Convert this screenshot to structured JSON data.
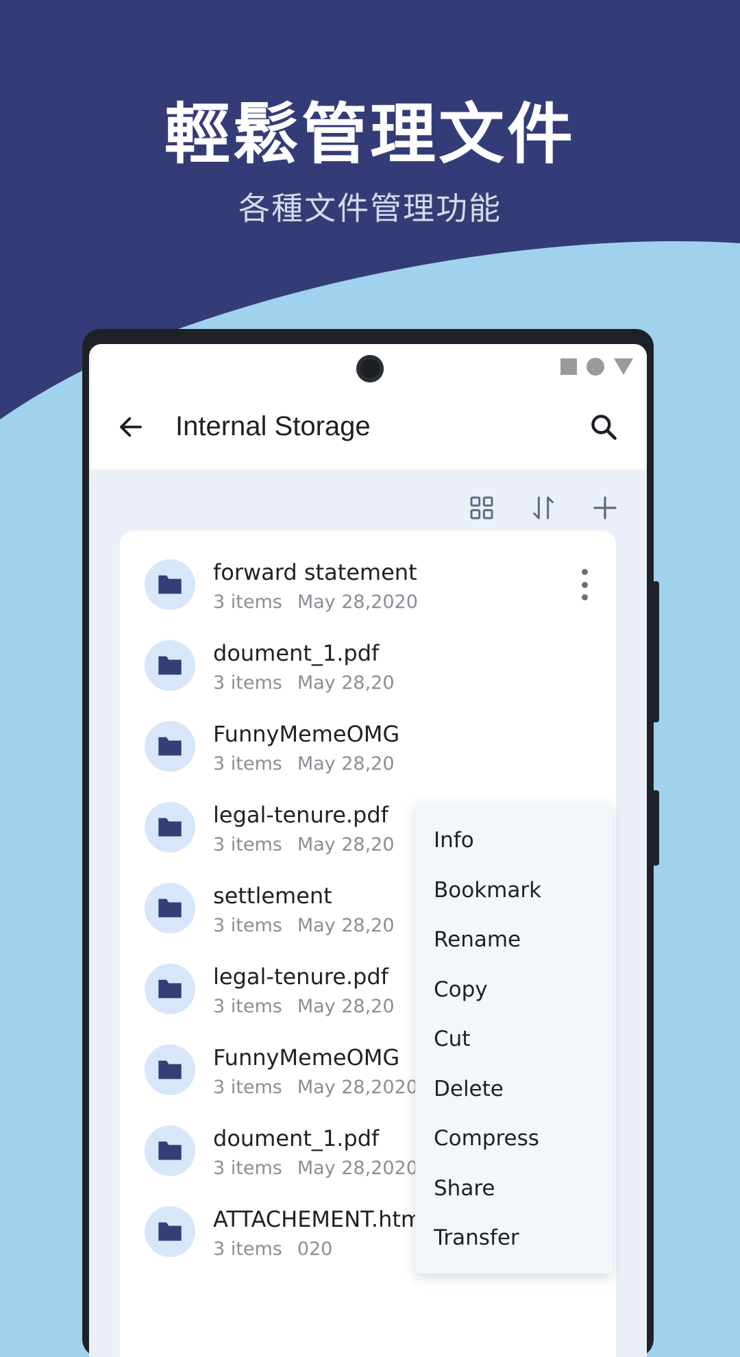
{
  "promo": {
    "title": "輕鬆管理文件",
    "subtitle": "各種文件管理功能"
  },
  "colors": {
    "navy": "#343c77",
    "sky": "#a0d2ee",
    "folder": "#353e75",
    "folder_bg": "#d8e6f9",
    "screen_bg": "#ebf0f8"
  },
  "app_bar": {
    "back_icon": "arrow-left-icon",
    "title": "Internal Storage",
    "search_icon": "search-icon"
  },
  "toolbar": {
    "grid_icon": "grid-view-icon",
    "sort_icon": "sort-icon",
    "add_icon": "plus-icon"
  },
  "files": [
    {
      "name": "forward statement",
      "items": "3 items",
      "date": "May 28,2020"
    },
    {
      "name": "doument_1.pdf",
      "items": "3 items",
      "date": "May 28,20"
    },
    {
      "name": "FunnyMemeOMG",
      "items": "3 items",
      "date": "May 28,20"
    },
    {
      "name": "legal-tenure.pdf",
      "items": "3 items",
      "date": "May 28,20"
    },
    {
      "name": "settlement",
      "items": "3 items",
      "date": "May 28,20"
    },
    {
      "name": "legal-tenure.pdf",
      "items": "3 items",
      "date": "May 28,20"
    },
    {
      "name": "FunnyMemeOMG",
      "items": "3 items",
      "date": "May 28,2020"
    },
    {
      "name": "doument_1.pdf",
      "items": "3 items",
      "date": "May 28,2020"
    },
    {
      "name": "ATTACHEMENT.html",
      "items": "3 items",
      "date": "020"
    }
  ],
  "context_menu": {
    "items": [
      "Info",
      "Bookmark",
      "Rename",
      "Copy",
      "Cut",
      "Delete",
      "Compress",
      "Share",
      "Transfer"
    ]
  }
}
